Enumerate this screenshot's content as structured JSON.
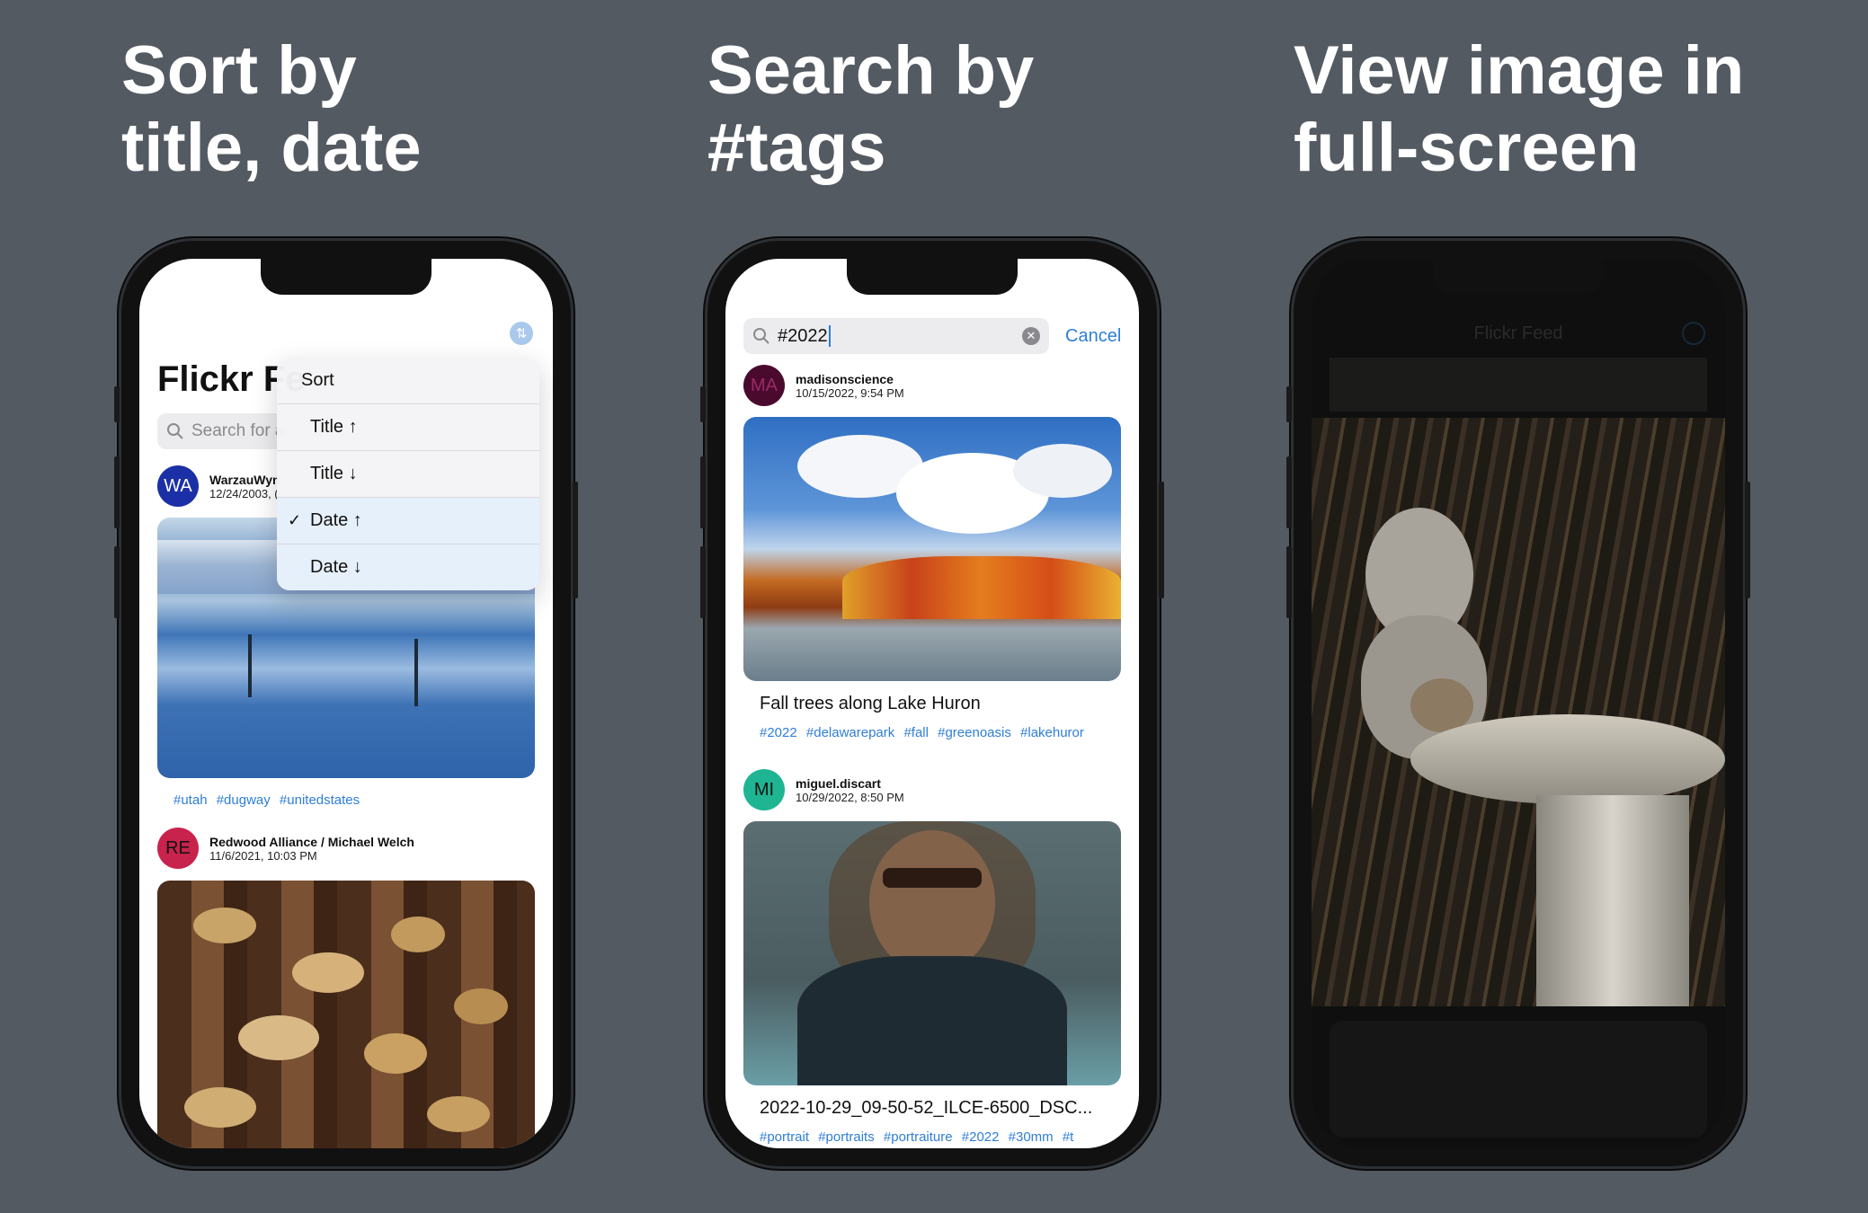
{
  "headlines": {
    "sort": [
      "Sort by",
      "title, date"
    ],
    "search": [
      "Search by",
      "#tags"
    ],
    "view": [
      "View image in",
      "full-screen"
    ]
  },
  "colors": {
    "background": "#545a62",
    "accent": "#2f7ed8"
  },
  "phone1": {
    "nav_title": "Flickr Fe",
    "sort_icon": "arrow-up-down-icon",
    "search_placeholder": "Search for a",
    "sort_menu": {
      "title": "Sort",
      "items": [
        {
          "label": "Title ↑",
          "checked": false
        },
        {
          "label": "Title ↓",
          "checked": false
        },
        {
          "label": "Date ↑",
          "checked": true
        },
        {
          "label": "Date ↓",
          "checked": false
        }
      ],
      "check_mark": "✓"
    },
    "posts": [
      {
        "initials": "WA",
        "avatar_color": "#1b2fa6",
        "user": "WarzauWyn",
        "date": "12/24/2003, (",
        "tags": "#utah #dugway #unitedstates"
      },
      {
        "initials": "RE",
        "avatar_color": "#c8234d",
        "user": "Redwood Alliance / Michael Welch",
        "date": "11/6/2021, 10:03 PM"
      }
    ]
  },
  "phone2": {
    "search_value": "#2022",
    "cancel_label": "Cancel",
    "posts": [
      {
        "initials": "MA",
        "avatar_color": "#4a0a2e",
        "user": "madisonscience",
        "date": "10/15/2022, 9:54 PM",
        "title": "Fall trees along Lake Huron",
        "tags": "#2022 #delawarepark #fall #greenoasis #lakehuror"
      },
      {
        "initials": "MI",
        "avatar_color": "#1fb592",
        "user": "miguel.discart",
        "date": "10/29/2022, 8:50 PM",
        "title": "2022-10-29_09-50-52_ILCE-6500_DSC...",
        "tags": "#portrait #portraits #portraiture #2022 #30mm #t"
      }
    ]
  },
  "phone3": {
    "nav_title": "Flickr Feed"
  }
}
